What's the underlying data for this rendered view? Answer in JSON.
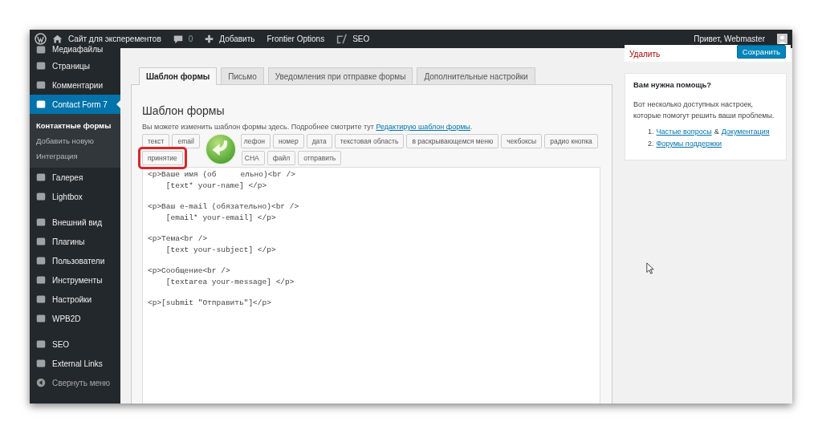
{
  "admin_bar": {
    "site": "Сайт для эксперементов",
    "comments": "0",
    "add": "Добавить",
    "links": [
      "Frontier Options",
      "SEO"
    ],
    "greeting": "Привет, Webmaster"
  },
  "sidebar": {
    "items": [
      {
        "label": "Медиафайлы",
        "selected": false
      },
      {
        "label": "Страницы",
        "selected": false
      },
      {
        "label": "Комментарии",
        "selected": false
      },
      {
        "label": "Contact Form 7",
        "selected": true,
        "children": [
          {
            "label": "Контактные формы",
            "selected": true
          },
          {
            "label": "Добавить новую",
            "selected": false
          },
          {
            "label": "Интеграция",
            "selected": false
          }
        ]
      },
      {
        "label": "Галерея",
        "selected": false
      },
      {
        "label": "Lightbox",
        "selected": false
      },
      {
        "label": "Внешний вид",
        "selected": false,
        "gap": true
      },
      {
        "label": "Плагины",
        "selected": false
      },
      {
        "label": "Пользователи",
        "selected": false
      },
      {
        "label": "Инструменты",
        "selected": false
      },
      {
        "label": "Настройки",
        "selected": false
      },
      {
        "label": "WPB2D",
        "selected": false
      },
      {
        "label": "SEO",
        "selected": false,
        "gap": true
      },
      {
        "label": "External Links",
        "selected": false
      },
      {
        "label": "Свернуть меню",
        "selected": false,
        "kind": "collapse"
      }
    ]
  },
  "tabs": [
    {
      "label": "Шаблон формы",
      "selected": true
    },
    {
      "label": "Письмо",
      "selected": false
    },
    {
      "label": "Уведомления при отправке формы",
      "selected": false
    },
    {
      "label": "Дополнительные настройки",
      "selected": false
    }
  ],
  "panel": {
    "title": "Шаблон формы",
    "description": "Вы можете изменить шаблон формы здесь. Подробнее смотрите тут",
    "link": "Редактирую шаблон формы",
    "link_end": ".",
    "tag_rows": [
      [
        {
          "label": "текст"
        },
        {
          "label": "email"
        },
        {
          "label": "лефон",
          "clipped": true
        },
        {
          "label": "номер"
        },
        {
          "label": "дата"
        },
        {
          "label": "текстовая область"
        },
        {
          "label": "в раскрывающемся меню"
        },
        {
          "label": "чекбоксы"
        },
        {
          "label": "радио кнопка"
        }
      ],
      [
        {
          "label": "принятие",
          "highlighted": true
        },
        {
          "label": "CHA",
          "clipped": true
        },
        {
          "label": "файл"
        },
        {
          "label": "отправить"
        }
      ]
    ],
    "code_blocks": [
      [
        [
          "<p>Ваше имя (об",
          "ельно)<br />"
        ],
        [
          "    [text* your-name] </p>"
        ]
      ],
      [
        [
          "<p>Ваш e-mail (обязательно)<br />"
        ],
        [
          "    [email* your-email] </p>"
        ]
      ],
      [
        [
          "<p>Тема<br />"
        ],
        [
          "    [text your-subject] </p>"
        ]
      ],
      [
        [
          "<p>Сообщение<br />"
        ],
        [
          "    [textarea your-message] </p>"
        ]
      ],
      [
        [
          "<p>[submit \"Отправить\"]</p>"
        ]
      ]
    ]
  },
  "actions": {
    "delete": "Удалить",
    "save": "Сохранить"
  },
  "help": {
    "title": "Вам нужна помощь?",
    "text": "Вот несколько доступных настроек, которые помогут решить ваши проблемы.",
    "items": [
      {
        "number": "1.",
        "links": [
          "Частые вопросы",
          "Документация"
        ],
        "joiner": "&"
      },
      {
        "number": "2.",
        "links": [
          "Форумы поддержки"
        ]
      }
    ]
  }
}
